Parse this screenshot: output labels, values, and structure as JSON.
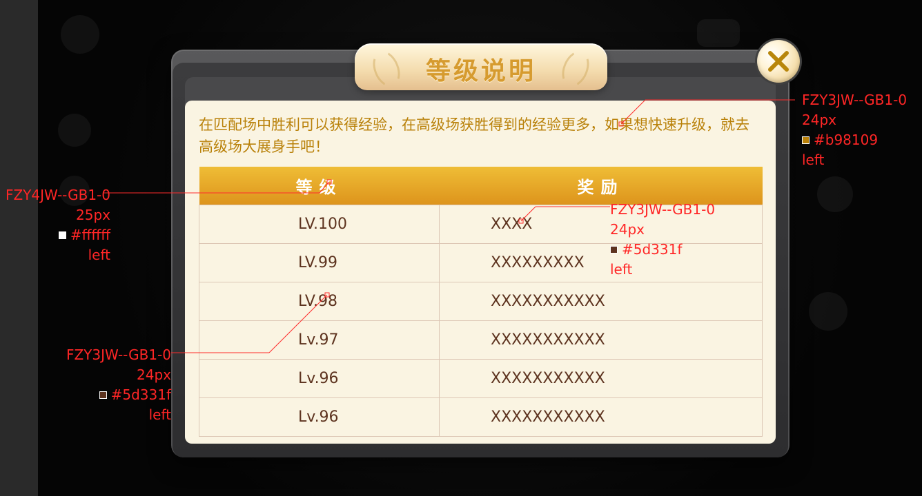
{
  "dialog": {
    "title": "等级说明",
    "description": "在匹配场中胜利可以获得经验，在高级场获胜得到的经验更多，如果想快速升级，就去高级场大展身手吧！"
  },
  "table": {
    "headers": [
      "等级",
      "奖励"
    ],
    "rows": [
      {
        "level": "LV.100",
        "reward": "XXXX"
      },
      {
        "level": "LV.99",
        "reward": "XXXXXXXXX"
      },
      {
        "level": "LV.98",
        "reward": "XXXXXXXXXXX"
      },
      {
        "level": "Lv.97",
        "reward": "XXXXXXXXXXX"
      },
      {
        "level": "Lv.96",
        "reward": "XXXXXXXXXXX"
      },
      {
        "level": "Lv.96",
        "reward": "XXXXXXXXXXX"
      }
    ]
  },
  "annotations": [
    {
      "font": "FZY3JW--GB1-0",
      "size": "24px",
      "color": "#b98109",
      "align": "left"
    },
    {
      "font": "FZY4JW--GB1-0",
      "size": "25px",
      "color": "#ffffff",
      "align": "left"
    },
    {
      "font": "FZY3JW--GB1-0",
      "size": "24px",
      "color": "#5d331f",
      "align": "left"
    },
    {
      "font": "FZY3JW--GB1-0",
      "size": "24px",
      "color": "#5d331f",
      "align": "left"
    }
  ],
  "icons": {
    "close": "close-icon"
  },
  "colors": {
    "description_text": "#b98109",
    "header_text": "#ffffff",
    "table_text": "#5d331f",
    "annotation_text": "#ff2626"
  }
}
